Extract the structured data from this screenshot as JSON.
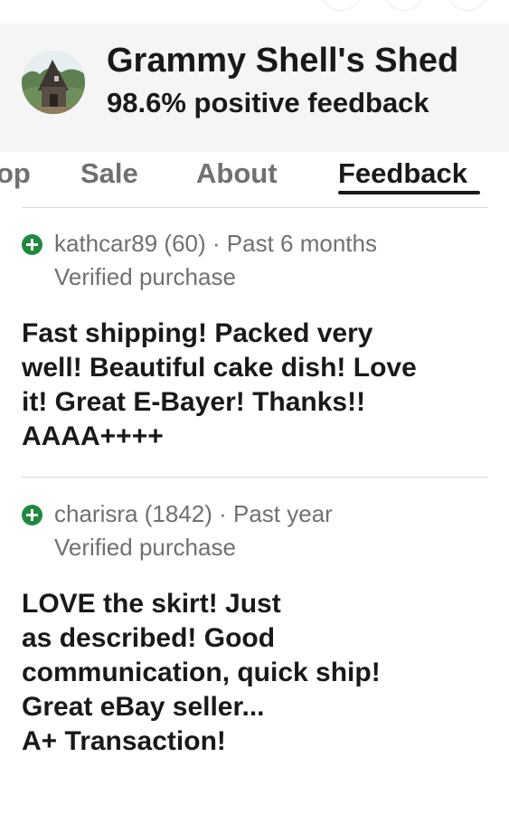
{
  "seller": {
    "name": "Grammy Shell's Shed",
    "positive_feedback": "98.6% positive feedback"
  },
  "tabs": [
    {
      "label": "Shop",
      "visible_fragment": "op"
    },
    {
      "label": "Sale"
    },
    {
      "label": "About"
    },
    {
      "label": "Feedback",
      "active": true
    }
  ],
  "reviews": [
    {
      "user": "kathcar89 (60)",
      "separator": "·",
      "time": "Past 6 months",
      "status": "Verified purchase",
      "comment_lines": [
        "Fast shipping! Packed very",
        "well! Beautiful cake dish! Love",
        "it! Great E-Bayer! Thanks!!",
        "AAAA++++"
      ]
    },
    {
      "user": "charisra (1842)",
      "separator": "·",
      "time": "Past year",
      "status": "Verified purchase",
      "comment_lines": [
        "LOVE the skirt! Just",
        "as described! Good",
        "communication, quick ship!",
        "Great eBay seller...",
        "A+ Transaction!"
      ]
    }
  ],
  "icons": {
    "positive": "plus-circle-icon",
    "avatar": "seller-avatar-shed-photo"
  },
  "colors": {
    "positive_green": "#1f8a3e",
    "header_bg": "#f5f5f5",
    "muted_text": "#707070",
    "primary_text": "#191919"
  }
}
